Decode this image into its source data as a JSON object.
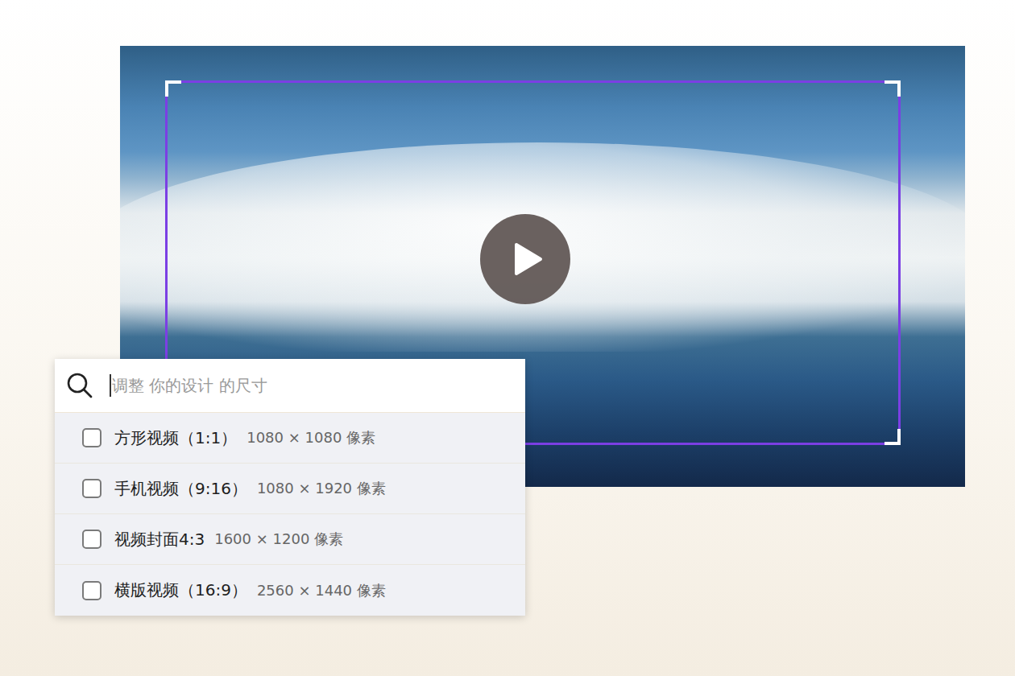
{
  "video": {
    "playing": false
  },
  "search": {
    "placeholder": "调整 你的设计 的尺寸"
  },
  "options": [
    {
      "label": "方形视频（1:1）",
      "size": "1080 × 1080 像素",
      "checked": false
    },
    {
      "label": "手机视频（9:16）",
      "size": "1080 × 1920 像素",
      "checked": false
    },
    {
      "label": "视频封面4:3",
      "size": "1600 × 1200 像素",
      "checked": false
    },
    {
      "label": "横版视频（16:9）",
      "size": "2560 × 1440 像素",
      "checked": false
    }
  ]
}
